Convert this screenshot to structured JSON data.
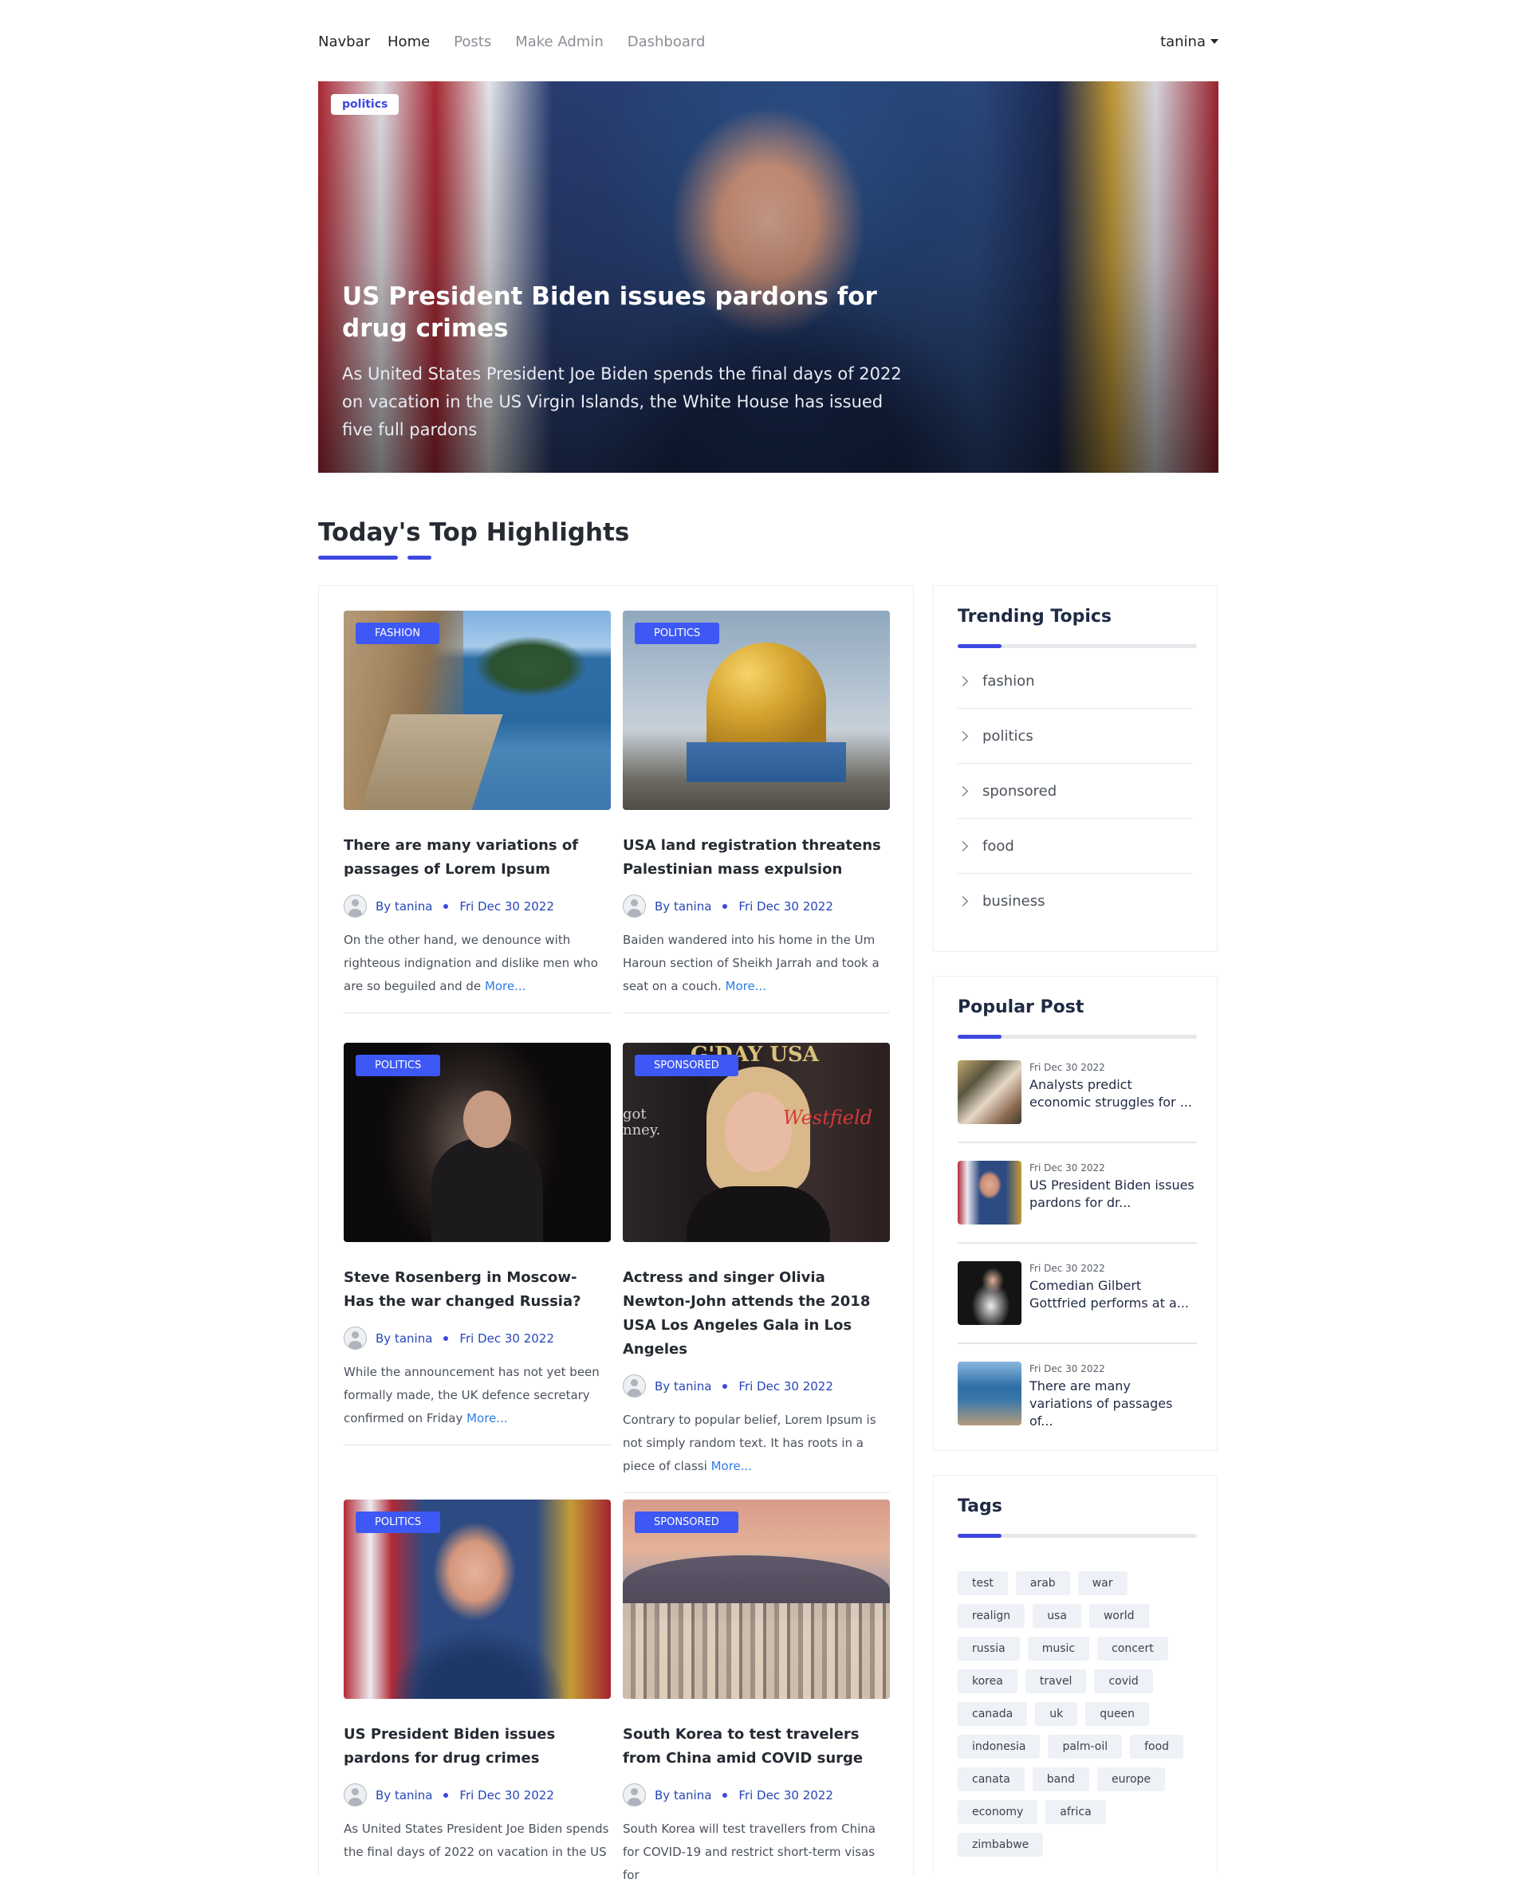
{
  "navbar": {
    "brand": "Navbar",
    "links": [
      "Home",
      "Posts",
      "Make Admin",
      "Dashboard"
    ],
    "user": "tanina"
  },
  "hero": {
    "category": "politics",
    "title": "US President Biden issues pardons for drug crimes",
    "description": "As United States President Joe Biden spends the final days of 2022 on vacation in the US Virgin Islands, the White House has issued five full pardons"
  },
  "highlights": {
    "heading": "Today's Top Highlights",
    "author_prefix": "By",
    "more_label": "More...",
    "posts": [
      {
        "category": "FASHION",
        "title": "There are many variations of passages of Lorem Ipsum",
        "author": "tanina",
        "date": "Fri Dec 30 2022",
        "excerpt": "On the other hand, we denounce with righteous indignation and dislike men who are so beguiled and de"
      },
      {
        "category": "POLITICS",
        "title": "USA land registration threatens Palestinian mass expulsion",
        "author": "tanina",
        "date": "Fri Dec 30 2022",
        "excerpt": "Baiden wandered into his home in the Um Haroun section of Sheikh Jarrah and took a seat on a couch."
      },
      {
        "category": "POLITICS",
        "title": "Steve Rosenberg in Moscow- Has the war changed Russia?",
        "author": "tanina",
        "date": "Fri Dec 30 2022",
        "excerpt": "While the announcement has not yet been formally made, the UK defence secretary confirmed on Friday"
      },
      {
        "category": "SPONSORED",
        "title": "Actress and singer Olivia Newton-John attends the 2018 USA Los Angeles Gala in Los Angeles",
        "author": "tanina",
        "date": "Fri Dec 30 2022",
        "excerpt": "Contrary to popular belief, Lorem Ipsum is not simply random text. It has roots in a piece of classi"
      },
      {
        "category": "POLITICS",
        "title": "US President Biden issues pardons for drug crimes",
        "author": "tanina",
        "date": "Fri Dec 30 2022",
        "excerpt": "As United States President Joe Biden spends the final days of 2022 on vacation in the US"
      },
      {
        "category": "SPONSORED",
        "title": "South Korea to test travelers from China amid COVID surge",
        "author": "tanina",
        "date": "Fri Dec 30 2022",
        "excerpt": "South Korea will test travellers from China for COVID-19 and restrict short-term visas for"
      }
    ],
    "image_texts": {
      "sign_top": "G'DAY USA",
      "sign_right": "Westfield",
      "sign_left": "got\nnney."
    }
  },
  "trending": {
    "title": "Trending Topics",
    "topics": [
      "fashion",
      "politics",
      "sponsored",
      "food",
      "business"
    ]
  },
  "popular": {
    "title": "Popular Post",
    "posts": [
      {
        "date": "Fri Dec 30 2022",
        "title": "Analysts predict economic struggles for ..."
      },
      {
        "date": "Fri Dec 30 2022",
        "title": "US President Biden issues pardons for dr..."
      },
      {
        "date": "Fri Dec 30 2022",
        "title": "Comedian Gilbert Gottfried performs at a..."
      },
      {
        "date": "Fri Dec 30 2022",
        "title": "There are many variations of passages of..."
      }
    ]
  },
  "tags": {
    "title": "Tags",
    "items": [
      "test",
      "arab",
      "war",
      "realign",
      "usa",
      "world",
      "russia",
      "music",
      "concert",
      "korea",
      "travel",
      "covid",
      "canada",
      "uk",
      "queen",
      "indonesia",
      "palm-oil",
      "food",
      "canata",
      "band",
      "europe",
      "economy",
      "africa",
      "zimbabwe"
    ]
  },
  "colors": {
    "accent": "#3d47e0",
    "category_badge": "#3d58f5",
    "link": "#2f7de3"
  }
}
